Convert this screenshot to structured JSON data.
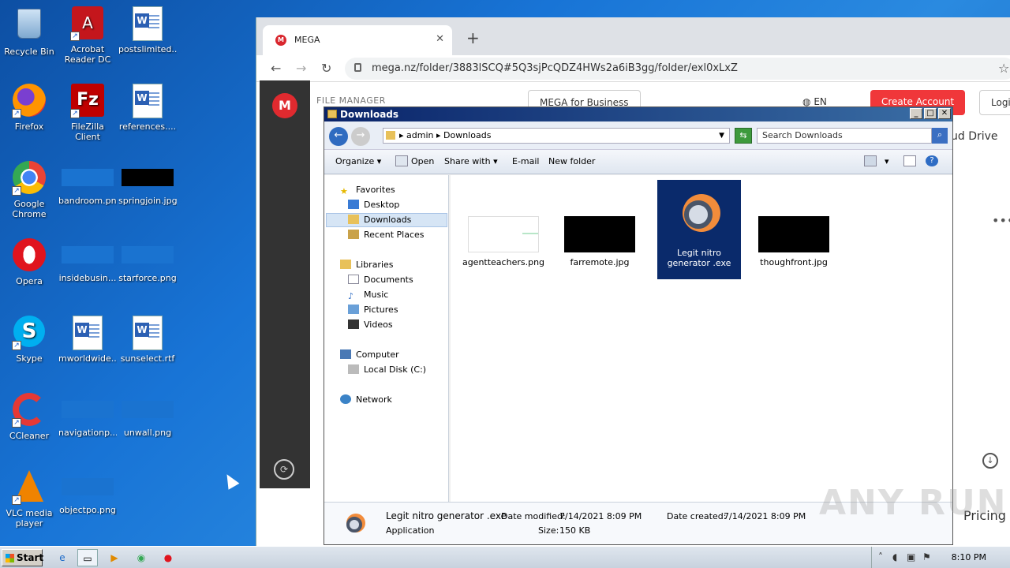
{
  "desktop": {
    "icons": [
      {
        "label": "Recycle Bin"
      },
      {
        "label": "Acrobat Reader DC"
      },
      {
        "label": "postslimited...."
      },
      {
        "label": "Firefox"
      },
      {
        "label": "FileZilla Client"
      },
      {
        "label": "references...."
      },
      {
        "label": "Google Chrome"
      },
      {
        "label": "bandroom.png"
      },
      {
        "label": "springjoin.jpg"
      },
      {
        "label": "Opera"
      },
      {
        "label": "insidebusin..."
      },
      {
        "label": "starforce.png"
      },
      {
        "label": "Skype"
      },
      {
        "label": "mworldwide...."
      },
      {
        "label": "sunselect.rtf"
      },
      {
        "label": "CCleaner"
      },
      {
        "label": "navigationp..."
      },
      {
        "label": "unwall.png"
      },
      {
        "label": "VLC media player"
      },
      {
        "label": "objectpo.png"
      }
    ]
  },
  "browser": {
    "tab_title": "MEGA",
    "url": "mega.nz/folder/3883lSCQ#5Q3sjPcQDZ4HWs2a6iB3gg/folder/exl0xLxZ",
    "file_manager_label": "FILE MANAGER",
    "mega_business": "MEGA for Business",
    "lang": "EN",
    "create_account": "Create Account",
    "login": "Login",
    "cloud_drive": "ud Drive",
    "pricing": "Pricing"
  },
  "explorer": {
    "title": "Downloads",
    "breadcrumb": [
      "admin",
      "Downloads"
    ],
    "search_placeholder": "Search Downloads",
    "toolbar": {
      "organize": "Organize",
      "open": "Open",
      "share_with": "Share with",
      "email": "E-mail",
      "new_folder": "New folder"
    },
    "nav": {
      "favorites": "Favorites",
      "desktop": "Desktop",
      "downloads": "Downloads",
      "recent_places": "Recent Places",
      "libraries": "Libraries",
      "documents": "Documents",
      "music": "Music",
      "pictures": "Pictures",
      "videos": "Videos",
      "computer": "Computer",
      "local_disk": "Local Disk (C:)",
      "network": "Network"
    },
    "files": [
      {
        "name": "agentteachers.png"
      },
      {
        "name": "farremote.jpg"
      },
      {
        "name": "Legit nitro generator .exe"
      },
      {
        "name": "thoughfront.jpg"
      }
    ],
    "details": {
      "name": "Legit nitro generator .exe",
      "type": "Application",
      "date_modified_label": "Date modified:",
      "date_modified": "7/14/2021 8:09 PM",
      "date_created_label": "Date created:",
      "date_created": "7/14/2021 8:09 PM",
      "size_label": "Size:",
      "size": "150 KB"
    }
  },
  "taskbar": {
    "start": "Start",
    "clock": "8:10 PM"
  },
  "watermark": "ANY RUN"
}
